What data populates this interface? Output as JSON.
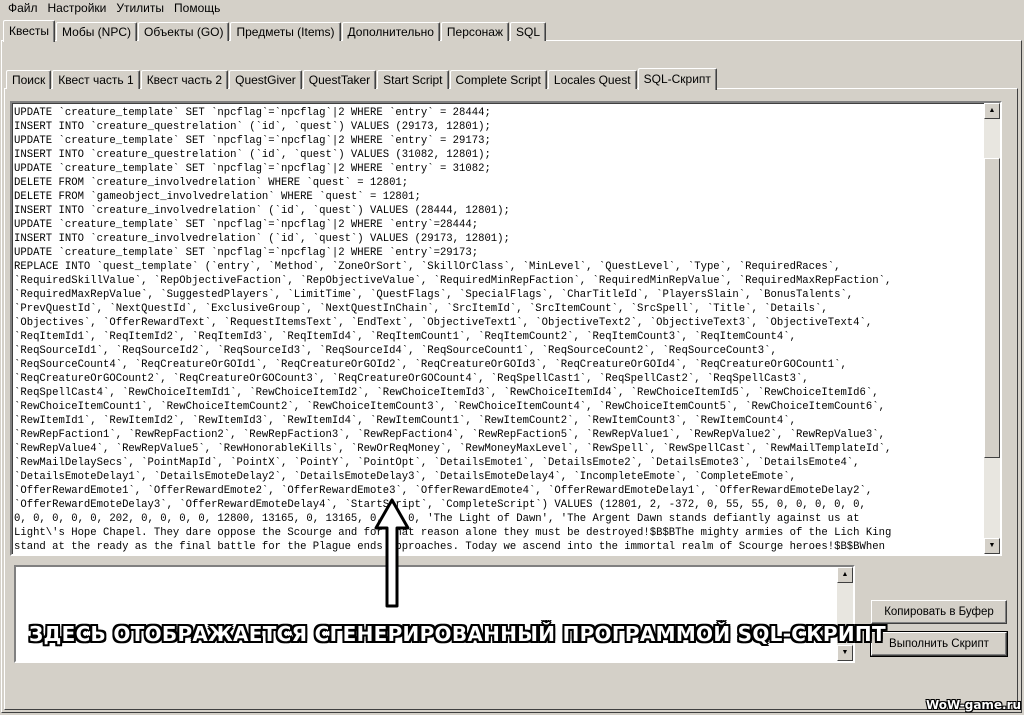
{
  "menu": [
    "Файл",
    "Настройки",
    "Утилиты",
    "Помощь"
  ],
  "main_tabs": [
    {
      "label": "Квесты",
      "active": true
    },
    {
      "label": "Мобы (NPC)",
      "active": false
    },
    {
      "label": "Объекты (GO)",
      "active": false
    },
    {
      "label": "Предметы (Items)",
      "active": false
    },
    {
      "label": "Дополнительно",
      "active": false
    },
    {
      "label": "Персонаж",
      "active": false
    },
    {
      "label": "SQL",
      "active": false
    }
  ],
  "sub_tabs": [
    {
      "label": "Поиск",
      "active": false
    },
    {
      "label": "Квест часть 1",
      "active": false
    },
    {
      "label": "Квест часть 2",
      "active": false
    },
    {
      "label": "QuestGiver",
      "active": false
    },
    {
      "label": "QuestTaker",
      "active": false
    },
    {
      "label": "Start Script",
      "active": false
    },
    {
      "label": "Complete Script",
      "active": false
    },
    {
      "label": "Locales Quest",
      "active": false
    },
    {
      "label": "SQL-Скрипт",
      "active": true
    }
  ],
  "sql_lines": [
    "UPDATE `creature_template` SET `npcflag`=`npcflag`|2 WHERE `entry` = 28444;",
    "INSERT INTO `creature_questrelation` (`id`, `quest`) VALUES (29173, 12801);",
    "UPDATE `creature_template` SET `npcflag`=`npcflag`|2 WHERE `entry` = 29173;",
    "INSERT INTO `creature_questrelation` (`id`, `quest`) VALUES (31082, 12801);",
    "UPDATE `creature_template` SET `npcflag`=`npcflag`|2 WHERE `entry` = 31082;",
    "DELETE FROM `creature_involvedrelation` WHERE `quest` = 12801;",
    "DELETE FROM `gameobject_involvedrelation` WHERE `quest` = 12801;",
    "INSERT INTO `creature_involvedrelation` (`id`, `quest`) VALUES (28444, 12801);",
    "UPDATE `creature_template` SET `npcflag`=`npcflag`|2 WHERE `entry`=28444;",
    "INSERT INTO `creature_involvedrelation` (`id`, `quest`) VALUES (29173, 12801);",
    "UPDATE `creature_template` SET `npcflag`=`npcflag`|2 WHERE `entry`=29173;",
    "REPLACE INTO `quest_template` (`entry`, `Method`, `ZoneOrSort`, `SkillOrClass`, `MinLevel`, `QuestLevel`, `Type`, `RequiredRaces`,",
    "`RequiredSkillValue`, `RepObjectiveFaction`, `RepObjectiveValue`, `RequiredMinRepFaction`, `RequiredMinRepValue`, `RequiredMaxRepFaction`,",
    "`RequiredMaxRepValue`, `SuggestedPlayers`, `LimitTime`, `QuestFlags`, `SpecialFlags`, `CharTitleId`, `PlayersSlain`, `BonusTalents`,",
    "`PrevQuestId`, `NextQuestId`, `ExclusiveGroup`, `NextQuestInChain`, `SrcItemId`, `SrcItemCount`, `SrcSpell`, `Title`, `Details`,",
    "`Objectives`, `OfferRewardText`, `RequestItemsText`, `EndText`, `ObjectiveText1`, `ObjectiveText2`, `ObjectiveText3`, `ObjectiveText4`,",
    "`ReqItemId1`, `ReqItemId2`, `ReqItemId3`, `ReqItemId4`, `ReqItemCount1`, `ReqItemCount2`, `ReqItemCount3`, `ReqItemCount4`,",
    "`ReqSourceId1`, `ReqSourceId2`, `ReqSourceId3`, `ReqSourceId4`, `ReqSourceCount1`, `ReqSourceCount2`, `ReqSourceCount3`,",
    "`ReqSourceCount4`, `ReqCreatureOrGOId1`, `ReqCreatureOrGOId2`, `ReqCreatureOrGOId3`, `ReqCreatureOrGOId4`, `ReqCreatureOrGOCount1`,",
    "`ReqCreatureOrGOCount2`, `ReqCreatureOrGOCount3`, `ReqCreatureOrGOCount4`, `ReqSpellCast1`, `ReqSpellCast2`, `ReqSpellCast3`,",
    "`ReqSpellCast4`, `RewChoiceItemId1`, `RewChoiceItemId2`, `RewChoiceItemId3`, `RewChoiceItemId4`, `RewChoiceItemId5`, `RewChoiceItemId6`,",
    "`RewChoiceItemCount1`, `RewChoiceItemCount2`, `RewChoiceItemCount3`, `RewChoiceItemCount4`, `RewChoiceItemCount5`, `RewChoiceItemCount6`,",
    "`RewItemId1`, `RewItemId2`, `RewItemId3`, `RewItemId4`, `RewItemCount1`, `RewItemCount2`, `RewItemCount3`, `RewItemCount4`,",
    "`RewRepFaction1`, `RewRepFaction2`, `RewRepFaction3`, `RewRepFaction4`, `RewRepFaction5`, `RewRepValue1`, `RewRepValue2`, `RewRepValue3`,",
    "`RewRepValue4`, `RewRepValue5`, `RewHonorableKills`, `RewOrReqMoney`, `RewMoneyMaxLevel`, `RewSpell`, `RewSpellCast`, `RewMailTemplateId`,",
    "`RewMailDelaySecs`, `PointMapId`, `PointX`, `PointY`, `PointOpt`, `DetailsEmote1`, `DetailsEmote2`, `DetailsEmote3`, `DetailsEmote4`,",
    "`DetailsEmoteDelay1`, `DetailsEmoteDelay2`, `DetailsEmoteDelay3`, `DetailsEmoteDelay4`, `IncompleteEmote`, `CompleteEmote`,",
    "`OfferRewardEmote1`, `OfferRewardEmote2`, `OfferRewardEmote3`, `OfferRewardEmote4`, `OfferRewardEmoteDelay1`, `OfferRewardEmoteDelay2`,",
    "`OfferRewardEmoteDelay3`, `OfferRewardEmoteDelay4`, `StartScript`, `CompleteScript`) VALUES (12801, 2, -372, 0, 55, 55, 0, 0, 0, 0, 0,",
    "0, 0, 0, 0, 0, 202, 0, 0, 0, 0, 12800, 13165, 0, 13165, 0, 0, 0, 'The Light of Dawn', 'The Argent Dawn stands defiantly against us at",
    "Light\\'s Hope Chapel. They dare oppose the Scourge and for that reason alone they must be destroyed!$B$BThe mighty armies of the Lich King",
    "stand at the ready as the final battle for the Plague ends approaches. Today we ascend into the immortal realm of Scourge heroes!$B$BWhen"
  ],
  "buttons": {
    "copy": "Копировать в Буфер",
    "run": "Выполнить Скрипт"
  },
  "annotation": "ЗДЕСЬ ОТОБРАЖАЕТСЯ  СГЕНЕРИРОВАННЫЙ ПРОГРАММОЙ SQL-СКРИПТ",
  "watermark": "WoW-game.ru"
}
